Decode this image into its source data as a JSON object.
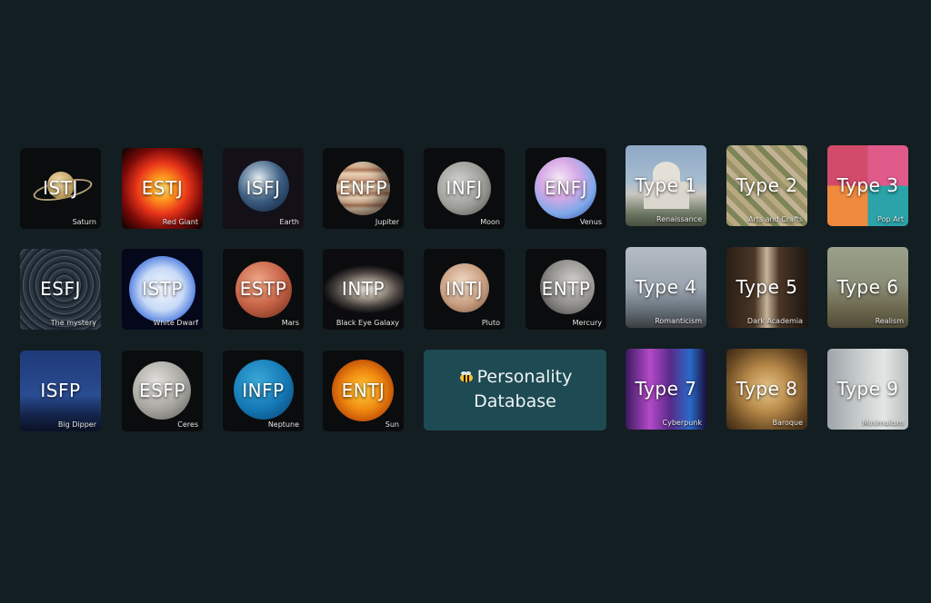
{
  "tiles": [
    {
      "label": "ISTJ",
      "caption": "Saturn"
    },
    {
      "label": "ESTJ",
      "caption": "Red Giant"
    },
    {
      "label": "ISFJ",
      "caption": "Earth"
    },
    {
      "label": "ENFP",
      "caption": "Jupiter"
    },
    {
      "label": "INFJ",
      "caption": "Moon"
    },
    {
      "label": "ENFJ",
      "caption": "Venus"
    },
    {
      "label": "Type 1",
      "caption": "Renaissance"
    },
    {
      "label": "Type 2",
      "caption": "Arts and Crafts"
    },
    {
      "label": "Type 3",
      "caption": "Pop Art"
    },
    {
      "label": "ESFJ",
      "caption": "The mystery"
    },
    {
      "label": "ISTP",
      "caption": "White Dwarf"
    },
    {
      "label": "ESTP",
      "caption": "Mars"
    },
    {
      "label": "INTP",
      "caption": "Black Eye Galaxy"
    },
    {
      "label": "INTJ",
      "caption": "Pluto"
    },
    {
      "label": "ENTP",
      "caption": "Mercury"
    },
    {
      "label": "Type 4",
      "caption": "Romanticism"
    },
    {
      "label": "Type 5",
      "caption": "Dark Academia"
    },
    {
      "label": "Type 6",
      "caption": "Realism"
    },
    {
      "label": "ISFP",
      "caption": "Big Dipper"
    },
    {
      "label": "ESFP",
      "caption": "Ceres"
    },
    {
      "label": "INFP",
      "caption": "Neptune"
    },
    {
      "label": "ENTJ",
      "caption": "Sun"
    },
    {
      "label": "Type 7",
      "caption": "Cyberpunk"
    },
    {
      "label": "Type 8",
      "caption": "Baroque"
    },
    {
      "label": "Type 9",
      "caption": "Minimalism"
    }
  ],
  "database": {
    "line1": "Personality",
    "line2": "Database"
  }
}
